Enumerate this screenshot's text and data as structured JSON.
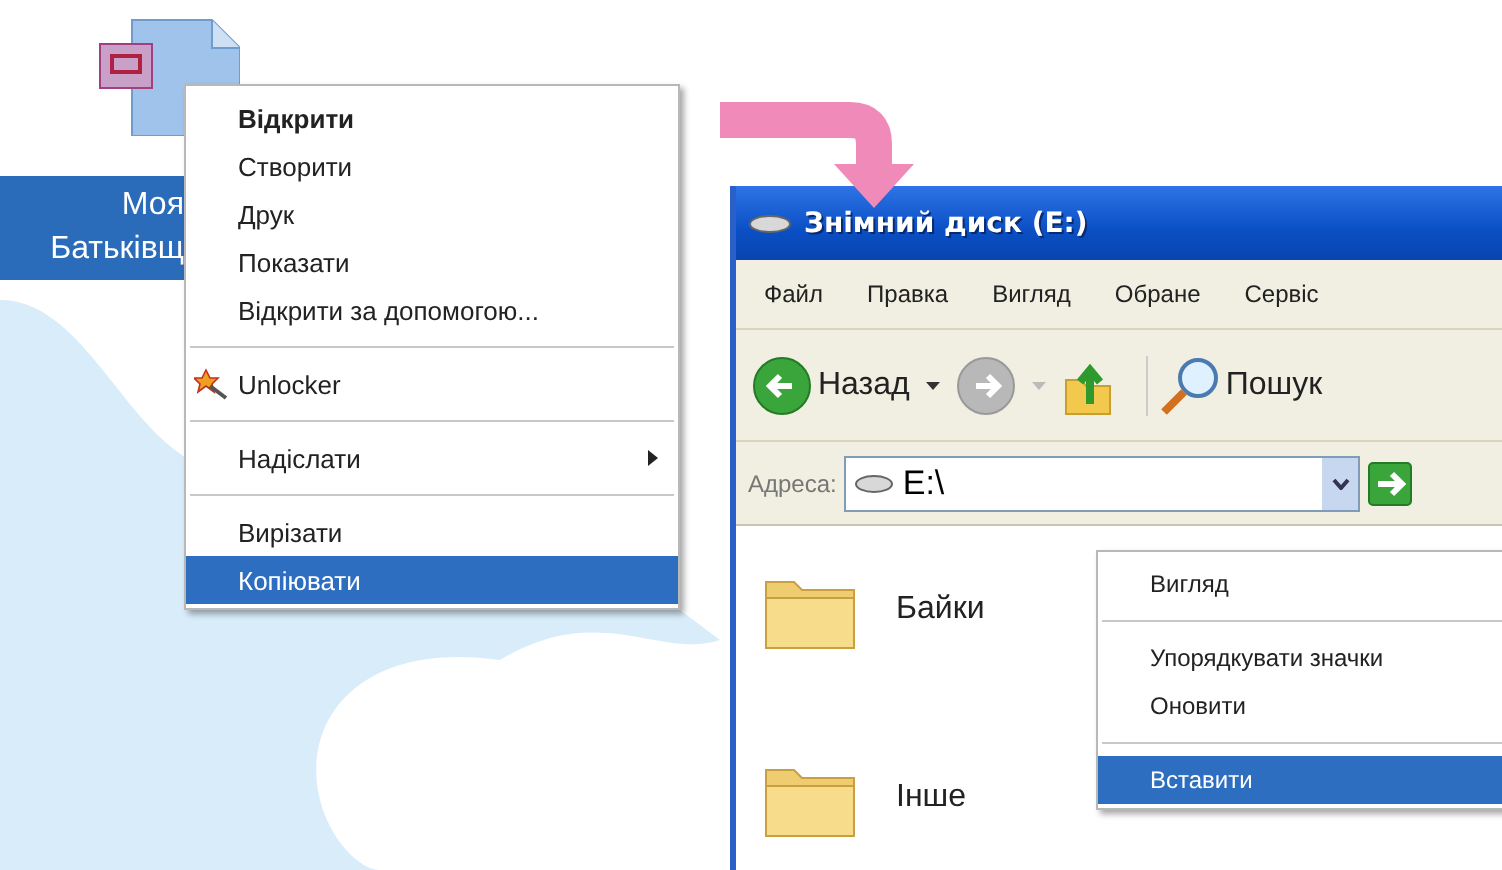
{
  "desktop_icon": {
    "label_lines": [
      "Моя",
      "Батьківщ"
    ],
    "selected": true
  },
  "file_menu": {
    "items": [
      {
        "kind": "item",
        "label": "Відкрити",
        "default": true,
        "selected": false
      },
      {
        "kind": "item",
        "label": "Створити",
        "default": false,
        "selected": false
      },
      {
        "kind": "item",
        "label": "Друк",
        "default": false,
        "selected": false
      },
      {
        "kind": "item",
        "label": "Показати",
        "default": false,
        "selected": false
      },
      {
        "kind": "item",
        "label": "Відкрити за допомогою...",
        "default": false,
        "selected": false
      },
      {
        "kind": "separator"
      },
      {
        "kind": "icon_item",
        "label": "Unlocker",
        "default": false,
        "selected": false
      },
      {
        "kind": "separator"
      },
      {
        "kind": "submenu",
        "label": "Надіслати",
        "default": false,
        "selected": false
      },
      {
        "kind": "separator"
      },
      {
        "kind": "item",
        "label": "Вирізати",
        "default": false,
        "selected": false
      },
      {
        "kind": "item",
        "label": "Копіювати",
        "default": false,
        "selected": true
      }
    ]
  },
  "explorer": {
    "title": "Знімний диск (E:)",
    "menu_bar": [
      "Файл",
      "Правка",
      "Вигляд",
      "Обране",
      "Сервіс"
    ],
    "toolbar": {
      "back": "Назад",
      "forward_disabled": true,
      "search": "Пошук"
    },
    "address": {
      "label": "Адреса:",
      "value": "E:\\"
    },
    "folders": [
      "Байки",
      "Інше"
    ],
    "context_menu": {
      "items": [
        {
          "kind": "item",
          "label": "Вигляд",
          "selected": false
        },
        {
          "kind": "separator"
        },
        {
          "kind": "item",
          "label": "Упорядкувати значки",
          "selected": false
        },
        {
          "kind": "item",
          "label": "Оновити",
          "selected": false
        },
        {
          "kind": "separator"
        },
        {
          "kind": "item",
          "label": "Вставити",
          "selected": true
        }
      ]
    }
  }
}
